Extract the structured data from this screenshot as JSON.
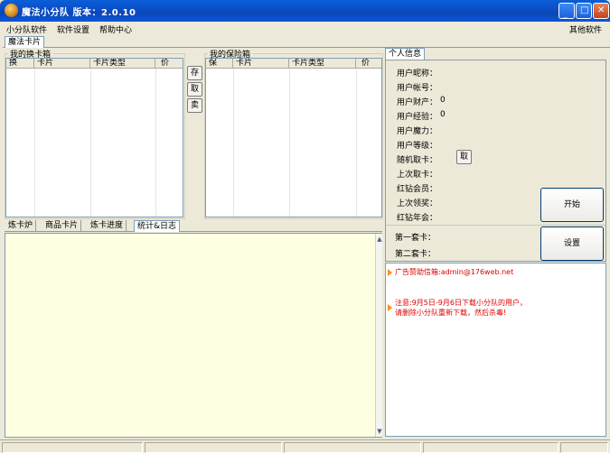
{
  "window": {
    "title": "魔法小分队  版本：2.0.10"
  },
  "menu": {
    "items": [
      "小分队软件",
      "软件设置",
      "帮助中心"
    ],
    "right_item": "其他软件"
  },
  "top_tab": "魔法卡片",
  "exchange_box": {
    "title": "我的换卡箱",
    "columns": [
      "换",
      "卡片",
      "卡片类型",
      "价"
    ]
  },
  "side_buttons": {
    "store": "存",
    "take": "取",
    "sell": "卖"
  },
  "safe_box": {
    "title": "我的保险箱",
    "columns": [
      "保",
      "卡片",
      "卡片类型",
      "价"
    ]
  },
  "bottom_tabs": [
    "炼卡炉",
    "商品卡片",
    "炼卡进度",
    "统计&日志"
  ],
  "bottom_tab_active": 3,
  "info": {
    "tab": "个人信息",
    "fields": [
      {
        "label": "用户昵称：",
        "value": ""
      },
      {
        "label": "用户帐号：",
        "value": ""
      },
      {
        "label": "用户财产：",
        "value": "0"
      },
      {
        "label": "用户经验：",
        "value": "0"
      },
      {
        "label": "用户魔力：",
        "value": ""
      },
      {
        "label": "用户等级：",
        "value": ""
      },
      {
        "label": "随机取卡：",
        "value": ""
      },
      {
        "label": "上次取卡：",
        "value": ""
      },
      {
        "label": "红钻会员：",
        "value": ""
      },
      {
        "label": "上次领奖：",
        "value": ""
      },
      {
        "label": "红钻年会：",
        "value": ""
      },
      {
        "label": "第一套卡：",
        "value": ""
      },
      {
        "label": "第二套卡：",
        "value": ""
      }
    ],
    "take_button": "取",
    "start_button": "开始",
    "settings_button": "设置"
  },
  "ads": {
    "line1": "广告赞助信箱:admin@176web.net",
    "line2a": "注意:9月5日-9月6日下载小分队的用户，",
    "line2b": "请删除小分队重新下载，然后杀毒!"
  },
  "colors": {
    "titlebar": "#0a4fc8",
    "log_bg": "#ffffe1",
    "ad_text": "#e00000",
    "ad_arrow": "#ff8c1a"
  }
}
